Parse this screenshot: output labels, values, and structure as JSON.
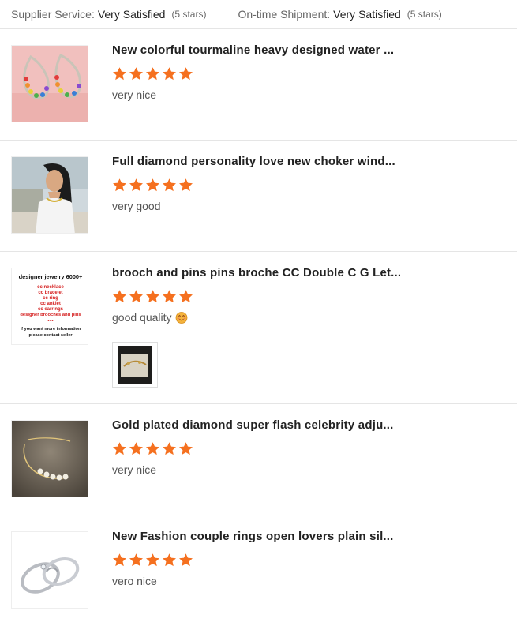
{
  "seller_ratings": {
    "supplier_service": {
      "label": "Supplier Service:",
      "value": "Very Satisfied",
      "stars": "(5 stars)"
    },
    "on_time_shipment": {
      "label": "On-time Shipment:",
      "value": "Very Satisfied",
      "stars": "(5 stars)"
    }
  },
  "reviews": [
    {
      "title": "New colorful tourmaline heavy designed water ...",
      "rating": 5,
      "comment": "very nice"
    },
    {
      "title": "Full diamond personality love new choker wind...",
      "rating": 5,
      "comment": "very good"
    },
    {
      "title": "brooch and pins pins broche CC Double C G Let...",
      "rating": 5,
      "comment": "good quality",
      "thumb_text": {
        "heading": "designer jewelry 6000+",
        "items": [
          "cc necklace",
          "cc bracelet",
          "cc ring",
          "cc anklet",
          "cc earrings",
          "designer brooches and pins",
          "......"
        ],
        "footer1": "if you want more information",
        "footer2": "please contact seller"
      }
    },
    {
      "title": "Gold plated diamond super flash celebrity adju...",
      "rating": 5,
      "comment": "very nice"
    },
    {
      "title": "New Fashion couple rings open lovers plain sil...",
      "rating": 5,
      "comment": "vero nice"
    }
  ],
  "colors": {
    "star": "#f5701f",
    "divider": "#e5e5e5",
    "title": "#222222"
  }
}
